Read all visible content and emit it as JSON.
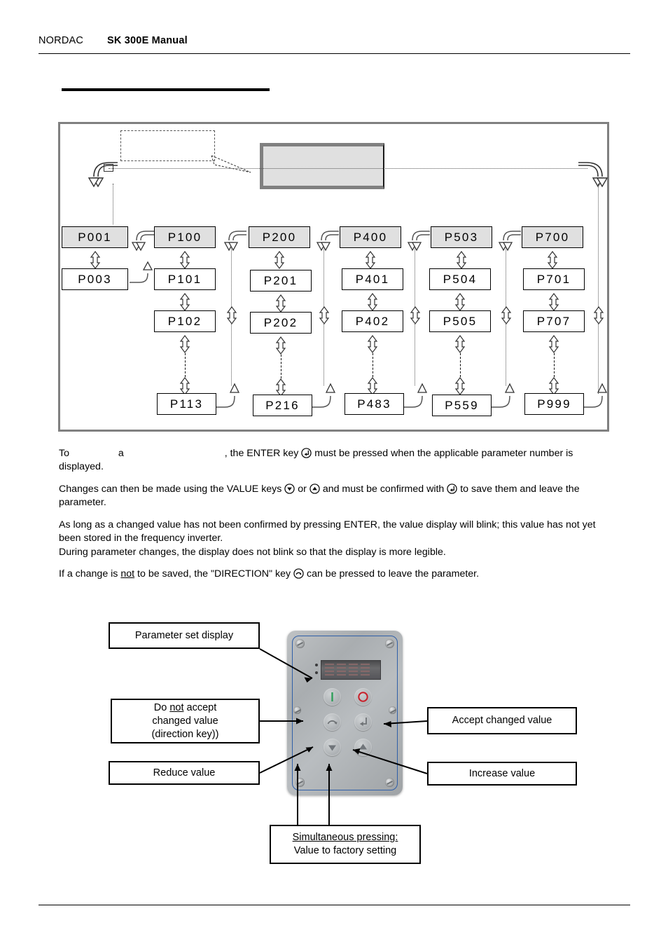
{
  "header": {
    "brand": "NORDAC",
    "title": "SK 300E Manual"
  },
  "section_heading": "",
  "diagram": {
    "name": "parameter-menu-structure",
    "callout_note": "",
    "gray_block_text": "",
    "columns": [
      {
        "head": "P001",
        "items": [
          "P003"
        ],
        "last": ""
      },
      {
        "head": "P100",
        "items": [
          "P101",
          "P102"
        ],
        "last": "P113"
      },
      {
        "head": "P200",
        "items": [
          "P201",
          "P202"
        ],
        "last": "P216"
      },
      {
        "head": "P400",
        "items": [
          "P401",
          "P402"
        ],
        "last": "P483"
      },
      {
        "head": "P503",
        "items": [
          "P504",
          "P505"
        ],
        "last": "P559"
      },
      {
        "head": "P700",
        "items": [
          "P701",
          "P707"
        ],
        "last": "P999"
      }
    ]
  },
  "body": {
    "p1_a": "To",
    "p1_b": "a",
    "p1_c": ", the ENTER key",
    "p1_d": "must be pressed when the applicable parameter number is displayed.",
    "p2_a": "Changes can then be made using the VALUE keys",
    "p2_or": "or",
    "p2_b": "and must be confirmed with",
    "p2_c": "to save them and leave the parameter.",
    "p3": "As long as a changed value has not been confirmed by pressing ENTER, the value display will blink; this value has not yet been stored in the frequency inverter.",
    "p4": "During parameter changes, the display does not blink so that the display is more legible.",
    "p5_a": "If a change is",
    "p5_not": "not",
    "p5_b": "to be saved, the \"DIRECTION\" key",
    "p5_c": "can be pressed to leave the parameter."
  },
  "figure": {
    "label_display": "Parameter set display",
    "label_direction_l1": "Do",
    "label_direction_not": "not",
    "label_direction_l1b": "accept",
    "label_direction_l2": "changed value",
    "label_direction_l3": "(direction key))",
    "label_reduce": "Reduce value",
    "label_accept": "Accept changed value",
    "label_increase": "Increase value",
    "label_factory_l1": "Simultaneous pressing:",
    "label_factory_l2": "Value to factory setting",
    "keypad": {
      "start_key": "I",
      "stop_key": "O",
      "direction_key": "direction",
      "enter_key": "enter",
      "down_key": "down",
      "up_key": "up"
    }
  },
  "colors": {
    "frame_gray": "#808080",
    "box_fill_gray": "#e0e0e0",
    "start_green": "#2f9e5a",
    "stop_red": "#c8202a",
    "panel_blue": "#2f5fa8"
  }
}
